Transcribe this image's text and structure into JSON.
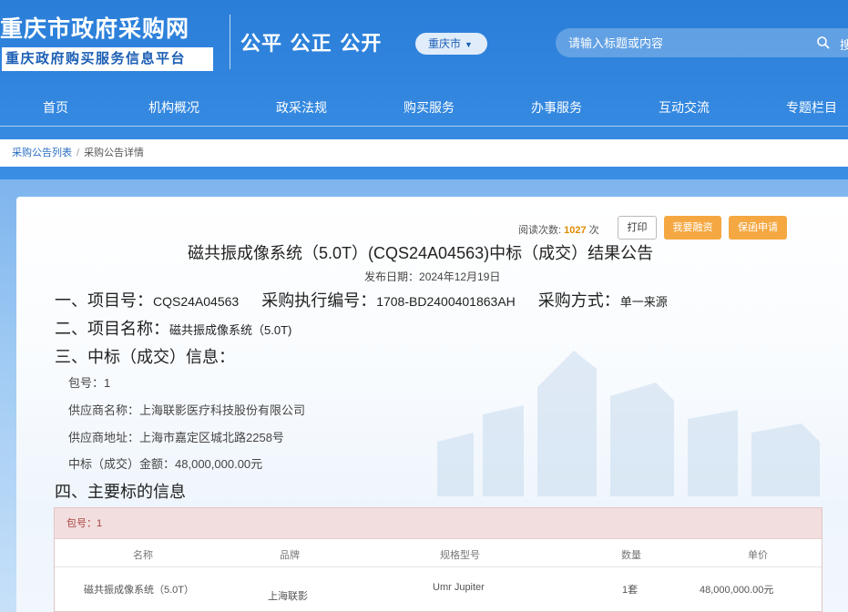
{
  "header": {
    "site_name": "重庆市政府采购网",
    "site_subtitle": "重庆政府购买服务信息平台",
    "slogan": "公平 公正 公开",
    "city_select": "重庆市",
    "search_placeholder": "请输入标题或内容",
    "search_button": "搜"
  },
  "nav": {
    "items": [
      "首页",
      "机构概况",
      "政采法规",
      "购买服务",
      "办事服务",
      "互动交流",
      "专题栏目"
    ]
  },
  "breadcrumb": {
    "link": "采购公告列表",
    "separator": "/",
    "current": "采购公告详情"
  },
  "toolbar": {
    "read_label": "阅读次数:",
    "read_count": "1027",
    "read_unit": "次",
    "print_label": "打印",
    "finance_label": "我要融资",
    "guarantee_label": "保函申请"
  },
  "notice": {
    "title": "磁共振成像系统（5.0T）(CQS24A04563)中标（成交）结果公告",
    "publish_label": "发布日期：",
    "publish_date": "2024年12月19日",
    "section1_label": "一、项目号：",
    "project_no": "CQS24A04563",
    "exec_label": "采购执行编号：",
    "exec_no": "1708-BD2400401863AH",
    "method_label": "采购方式：",
    "method": "单一来源",
    "section2_label": "二、项目名称：",
    "project_name": "磁共振成像系统（5.0T)",
    "section3_label": "三、中标（成交）信息：",
    "package_label": "包号：",
    "package_no": "1",
    "supplier_label": "供应商名称：",
    "supplier_name": "上海联影医疗科技股份有限公司",
    "address_label": "供应商地址：",
    "supplier_address": "上海市嘉定区城北路2258号",
    "amount_label": "中标（成交）金额：",
    "amount": "48,000,000.00元",
    "section4_label": "四、主要标的信息"
  },
  "subject_table": {
    "package_header": "包号：1",
    "columns": [
      "名称",
      "品牌",
      "规格型号",
      "数量",
      "单价"
    ],
    "rows": [
      {
        "name": "磁共振成像系统（5.0T）",
        "brand": "上海联影",
        "model": "Umr Jupiter",
        "qty": "1套",
        "price": "48,000,000.00元"
      }
    ]
  },
  "colors": {
    "header_blue": "#2a7ed8",
    "accent_orange": "#f5a842",
    "package_header_bg": "#f2dede",
    "package_header_text": "#a94442"
  }
}
